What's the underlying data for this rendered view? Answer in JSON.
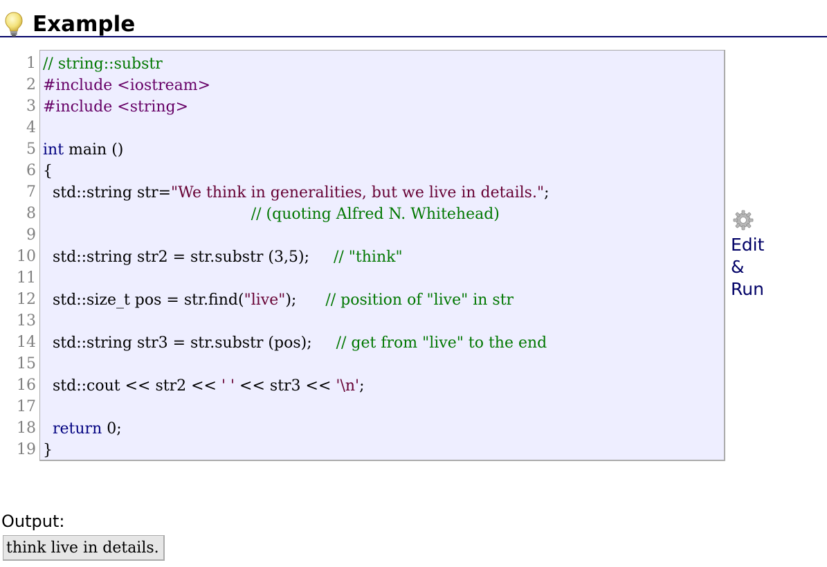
{
  "header": {
    "icon": "lightbulb-icon",
    "title": "Example"
  },
  "code": {
    "line_numbers": [
      "1",
      "2",
      "3",
      "4",
      "5",
      "6",
      "7",
      "8",
      "9",
      "10",
      "11",
      "12",
      "13",
      "14",
      "15",
      "16",
      "17",
      "18",
      "19"
    ],
    "lines": [
      [
        {
          "t": "comment",
          "v": "// string::substr"
        }
      ],
      [
        {
          "t": "pre",
          "v": "#include <iostream>"
        }
      ],
      [
        {
          "t": "pre",
          "v": "#include <string>"
        }
      ],
      [],
      [
        {
          "t": "kw",
          "v": "int"
        },
        {
          "t": "plain",
          "v": " main ()"
        }
      ],
      [
        {
          "t": "plain",
          "v": "{"
        }
      ],
      [
        {
          "t": "plain",
          "v": "  std::string str="
        },
        {
          "t": "str",
          "v": "\"We think in generalities, but we live in details.\""
        },
        {
          "t": "plain",
          "v": ";"
        }
      ],
      [
        {
          "t": "plain",
          "v": "                                           "
        },
        {
          "t": "comment",
          "v": "// (quoting Alfred N. Whitehead)"
        }
      ],
      [],
      [
        {
          "t": "plain",
          "v": "  std::string str2 = str.substr (3,5);     "
        },
        {
          "t": "comment",
          "v": "// \"think\""
        }
      ],
      [],
      [
        {
          "t": "plain",
          "v": "  std::size_t pos = str.find("
        },
        {
          "t": "str",
          "v": "\"live\""
        },
        {
          "t": "plain",
          "v": ");      "
        },
        {
          "t": "comment",
          "v": "// position of \"live\" in str"
        }
      ],
      [],
      [
        {
          "t": "plain",
          "v": "  std::string str3 = str.substr (pos);     "
        },
        {
          "t": "comment",
          "v": "// get from \"live\" to the end"
        }
      ],
      [],
      [
        {
          "t": "plain",
          "v": "  std::cout << str2 << "
        },
        {
          "t": "str",
          "v": "' '"
        },
        {
          "t": "plain",
          "v": " << str3 << "
        },
        {
          "t": "str",
          "v": "'\\n'"
        },
        {
          "t": "plain",
          "v": ";"
        }
      ],
      [],
      [
        {
          "t": "plain",
          "v": "  "
        },
        {
          "t": "kw",
          "v": "return"
        },
        {
          "t": "plain",
          "v": " 0;"
        }
      ],
      [
        {
          "t": "plain",
          "v": "}"
        }
      ]
    ]
  },
  "edit_run": {
    "icon": "gear-icon",
    "line1": "Edit",
    "line2": "&",
    "line3": "Run"
  },
  "output": {
    "label": "Output:",
    "text": "think live in details."
  },
  "colors": {
    "code_background": "#eeeeff",
    "comment": "#007700",
    "preprocessor": "#660066",
    "keyword": "#000080",
    "string": "#660033",
    "link": "#000066",
    "header_rule": "#000066"
  }
}
